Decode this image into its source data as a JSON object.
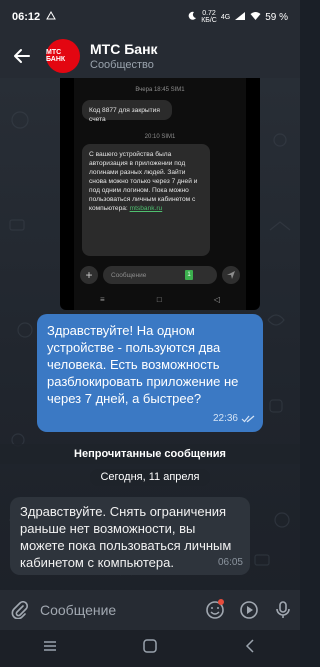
{
  "status_bar": {
    "time": "06:12",
    "net_speed_top": "0.72",
    "net_speed_bottom": "КБ/С",
    "battery": "59 %",
    "network": "4G"
  },
  "header": {
    "title": "МТС Банк",
    "subtitle": "Сообщество",
    "avatar_text": "МТС БАНК"
  },
  "screenshot_message": {
    "meta1": "Вчера 18:45 SIM1",
    "sms1": "Код 8877 для закрытия счета",
    "meta2": "20:10 SIM1",
    "sms2_text": "С вашего устройства была авторизация в приложении под логинами разных людей. Зайти снова можно только через 7 дней и под одним логином. Пока можно пользоваться личным кабинетом с компьютера:",
    "sms2_link": "mtsbank.ru",
    "compose_placeholder": "Сообщение",
    "sim_badge": "1"
  },
  "outgoing_message": {
    "text": "Здравствуйте! На одном устройстве - пользуются два человека. Есть возможность разблокировать приложение не через 7 дней, а быстрее?",
    "time": "22:36"
  },
  "unread_divider": "Непрочитанные сообщения",
  "date_pill": "Сегодня, 11 апреля",
  "incoming_message": {
    "text": "Здравствуйте. Снять ограничения раньше нет возможности, вы можете пока пользоваться личным кабинетом с компьютера.",
    "time": "06:05"
  },
  "composer": {
    "placeholder": "Сообщение"
  },
  "colors": {
    "outgoing_bubble": "#3b79c4",
    "incoming_bubble": "#2e343c",
    "header_bg": "#262b33",
    "avatar_bg": "#e30611"
  }
}
